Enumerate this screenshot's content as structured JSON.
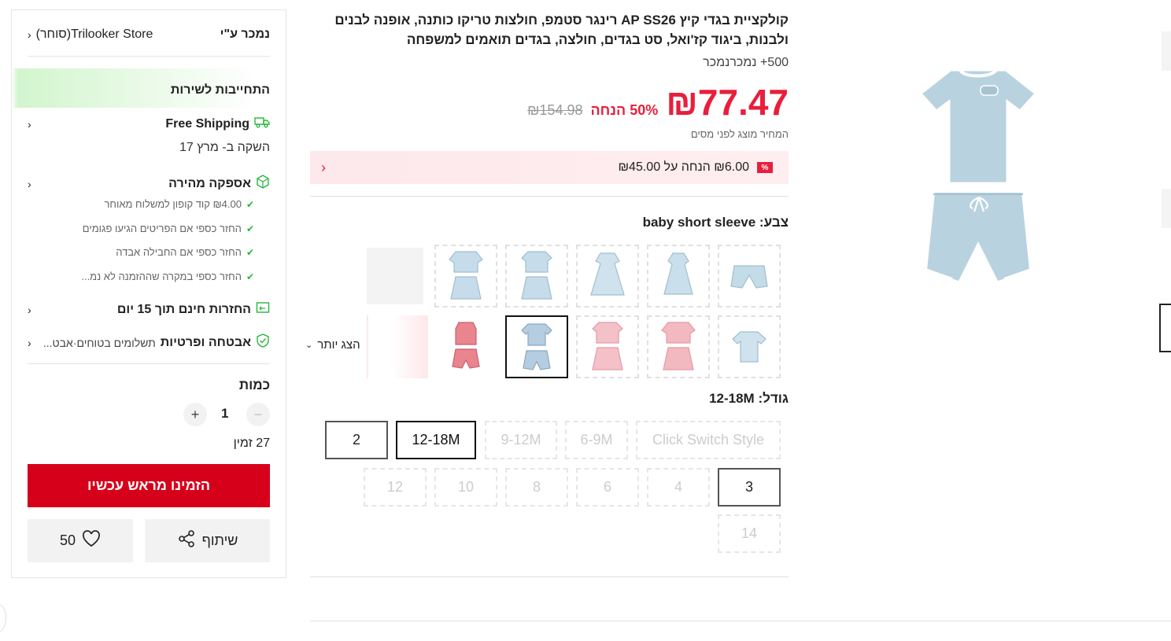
{
  "seller": {
    "label": "נמכר ע\"י",
    "store": "Trilooker Store(סוחר)"
  },
  "service": {
    "title": "התחייבות לשירות",
    "free_shipping": "Free Shipping",
    "delivery": "השקה ב- מרץ 17",
    "fast_delivery": "אספקה מהירה",
    "bullets": [
      "₪4.00 קוד קופון למשלוח מאוחר",
      "החזר כספי אם הפריטים הגיעו פגומים",
      "החזר כספי אם החבילה אבדה",
      "החזר כספי במקרה שההזמנה לא נמ..."
    ],
    "returns": "החזרות חינם תוך 15 יום",
    "security": "אבטחה ופרטיות",
    "security_sub": "תשלומים בטוחים·אבט..."
  },
  "quantity": {
    "label": "כמות",
    "value": "1",
    "available": "27 זמין",
    "minus": "−",
    "plus": "+"
  },
  "buttons": {
    "preorder": "הזמינו מראש עכשיו",
    "share": "שיתוף",
    "wishlist_count": "50"
  },
  "product": {
    "title": "קולקציית בגדי קיץ AP SS26 רינגר סטמפ, חולצות טריקו כותנה, אופנה לבנים ולבנות, ביגוד קז'ואל, סט בגדים, חולצה, בגדים תואמים למשפחה",
    "sold": "500+ נמכרנמכר",
    "price": "₪77.47",
    "discount": "50% הנחה",
    "original_price": "₪154.98",
    "tax_note": "המחיר מוצג לפני מסים",
    "coupon": "₪6.00 הנחה על ₪45.00",
    "coupon_tag": "%"
  },
  "color": {
    "label": "צבע:",
    "selected": "baby short sleeve",
    "show_more": "הצג יותר"
  },
  "size": {
    "label": "גודל:",
    "selected": "12-18M",
    "options": [
      "Click Switch Style",
      "6-9M",
      "9-12M",
      "12-18M",
      "2",
      "3",
      "4",
      "6",
      "8",
      "10",
      "12",
      "14"
    ]
  },
  "colors": {
    "accent": "#e91e3c",
    "buy": "#d7001a",
    "green": "#26b63c"
  }
}
